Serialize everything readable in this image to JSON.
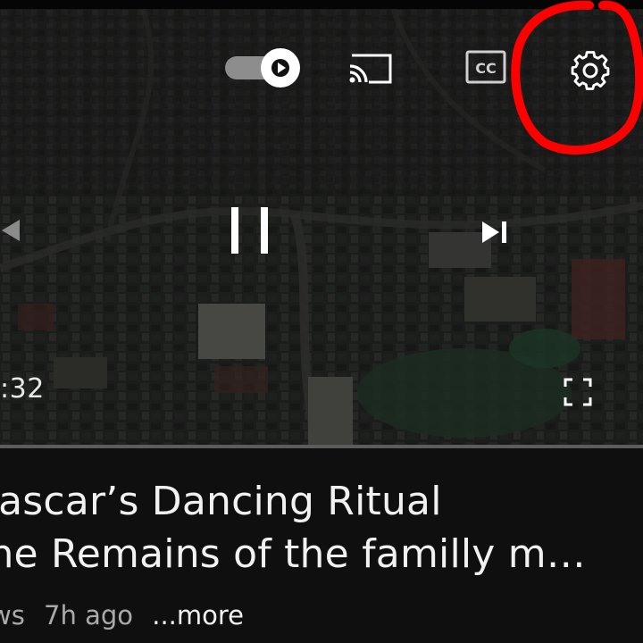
{
  "player": {
    "autoplay": {
      "state": "on"
    },
    "captions_label": "CC",
    "time": ":32",
    "progress_fraction": 0.0,
    "controls": [
      "autoplay-toggle",
      "cast",
      "captions",
      "settings",
      "previous",
      "pause",
      "next",
      "fullscreen"
    ],
    "highlight_color": "#ff0000"
  },
  "video": {
    "title_line1": "gascar’s Dancing Ritual",
    "title_line2": "the Remains of the familly m…",
    "views": "ws",
    "age": "7h ago",
    "more": "...more"
  },
  "icons": [
    "play-icon",
    "cast-icon",
    "cc-icon",
    "gear-icon",
    "previous-icon",
    "pause-icon",
    "next-icon",
    "fullscreen-icon"
  ]
}
